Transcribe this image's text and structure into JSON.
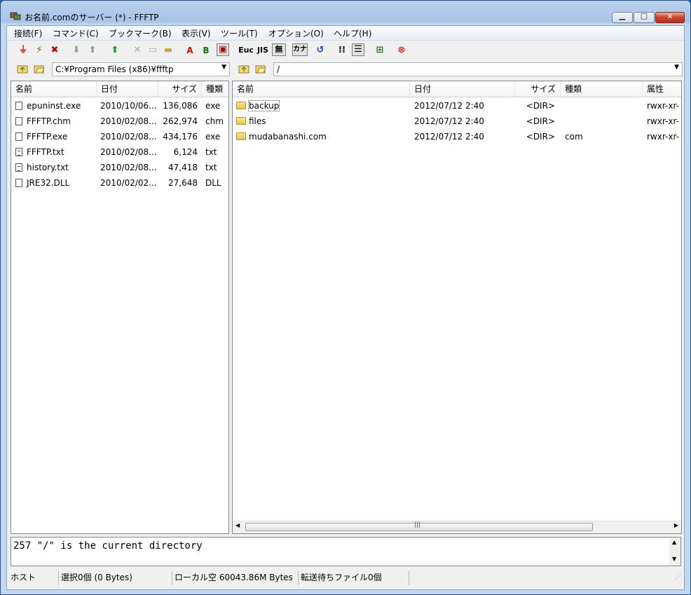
{
  "window": {
    "title": "お名前.comのサーバー (*) - FFFTP"
  },
  "menu": [
    "接続(F)",
    "コマンド(C)",
    "ブックマーク(B)",
    "表示(V)",
    "ツール(T)",
    "オプション(O)",
    "ヘルプ(H)"
  ],
  "toolbar": {
    "icons": [
      "connect-icon",
      "quick-connect-icon",
      "disconnect-icon",
      "download-icon",
      "upload-icon",
      "mirror-upload-icon",
      "delete-icon",
      "rename-icon",
      "mkdir-icon",
      "ascii-mode-icon",
      "binary-mode-icon",
      "auto-mode-icon",
      "euc-icon",
      "jis-icon",
      "no-convert-icon",
      "kana-icon",
      "refresh-icon",
      "list-view-icon",
      "details-view-icon",
      "sync-icon",
      "stop-icon"
    ],
    "labels": {
      "ascii": "A",
      "binary": "B",
      "euc": "Euc",
      "jis": "JIS",
      "none": "無",
      "kana": "カナ"
    }
  },
  "local": {
    "path": "C:¥Program Files (x86)¥ffftp",
    "columns": [
      "名前",
      "日付",
      "サイズ",
      "種類"
    ],
    "files": [
      {
        "name": "epuninst.exe",
        "date": "2010/10/06...",
        "size": "136,086",
        "type": "exe",
        "icon": "file"
      },
      {
        "name": "FFFTP.chm",
        "date": "2010/02/08...",
        "size": "262,974",
        "type": "chm",
        "icon": "file"
      },
      {
        "name": "FFFTP.exe",
        "date": "2010/02/08...",
        "size": "434,176",
        "type": "exe",
        "icon": "file"
      },
      {
        "name": "FFFTP.txt",
        "date": "2010/02/08...",
        "size": "6,124",
        "type": "txt",
        "icon": "txt"
      },
      {
        "name": "history.txt",
        "date": "2010/02/08...",
        "size": "47,418",
        "type": "txt",
        "icon": "txt"
      },
      {
        "name": "JRE32.DLL",
        "date": "2010/02/02...",
        "size": "27,648",
        "type": "DLL",
        "icon": "file"
      }
    ]
  },
  "remote": {
    "path": "/",
    "columns": [
      "名前",
      "日付",
      "サイズ",
      "種類",
      "属性"
    ],
    "files": [
      {
        "name": "backup",
        "date": "2012/07/12  2:40",
        "size": "<DIR>",
        "type": "",
        "attr": "rwxr-xr-"
      },
      {
        "name": "files",
        "date": "2012/07/12  2:40",
        "size": "<DIR>",
        "type": "",
        "attr": "rwxr-xr-"
      },
      {
        "name": "mudabanashi.com",
        "date": "2012/07/12  2:40",
        "size": "<DIR>",
        "type": "com",
        "attr": "rwxr-xr-"
      }
    ]
  },
  "log": {
    "text": "257 \"/\" is the current directory"
  },
  "status": {
    "host": "ホスト",
    "selection": "選択0個  (0 Bytes)",
    "local_free": "ローカル空 60043.86M Bytes",
    "queue": "転送待ちファイル0個"
  }
}
